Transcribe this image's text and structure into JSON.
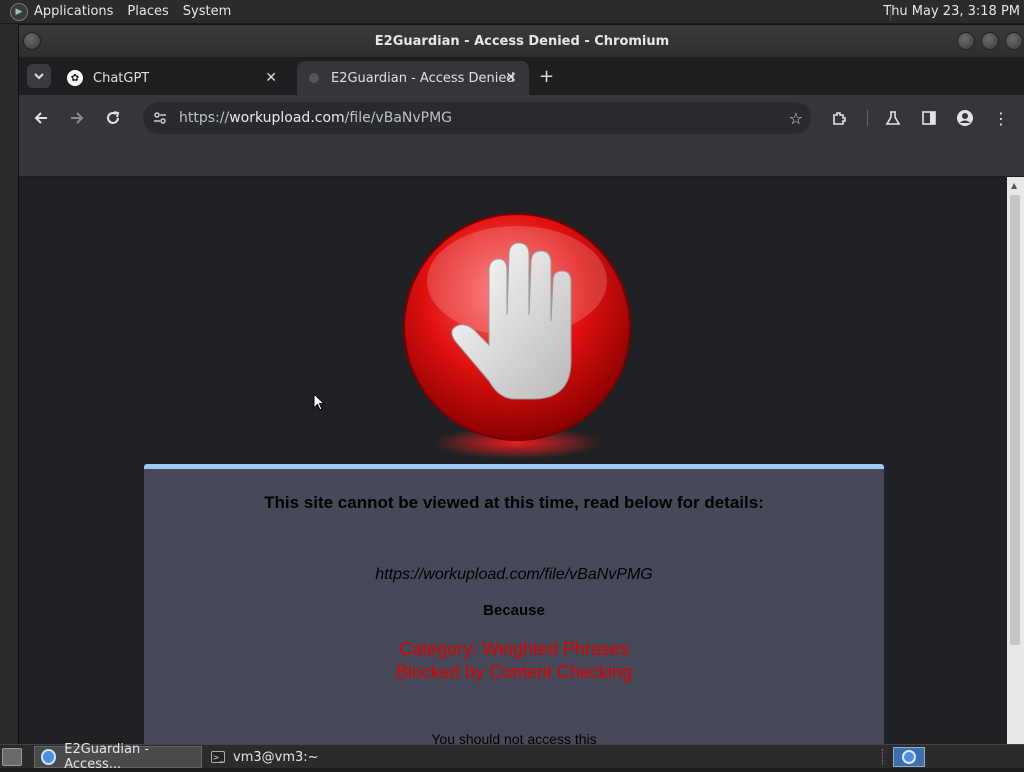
{
  "top_panel": {
    "menus": [
      "Applications",
      "Places",
      "System"
    ],
    "clock": "Thu May 23,  3:18 PM"
  },
  "window": {
    "title": "E2Guardian - Access Denied - Chromium"
  },
  "tabs": [
    {
      "label": "ChatGPT",
      "active": false
    },
    {
      "label": "E2Guardian - Access Denied",
      "active": true
    }
  ],
  "toolbar": {
    "url_scheme": "https://",
    "url_host": "workupload.com",
    "url_path": "/file/vBaNvPMG"
  },
  "page": {
    "heading": "This site cannot be viewed at this time, read below for details:",
    "blocked_url": "https://workupload.com/file/vBaNvPMG",
    "because_label": "Because",
    "reason_line1": "Category: Weighted Phrases",
    "reason_line2": "Blocked by Content Checking",
    "partial_text": "You should not access this"
  },
  "taskbar": {
    "tasks": [
      {
        "label": "E2Guardian - Access...",
        "active": true
      },
      {
        "label": "vm3@vm3:~",
        "active": false
      }
    ]
  },
  "colors": {
    "panel_bg": "#464a58",
    "panel_accent": "#9ec9f3",
    "reason_red": "#e00000",
    "browser_chrome": "#35363a"
  }
}
